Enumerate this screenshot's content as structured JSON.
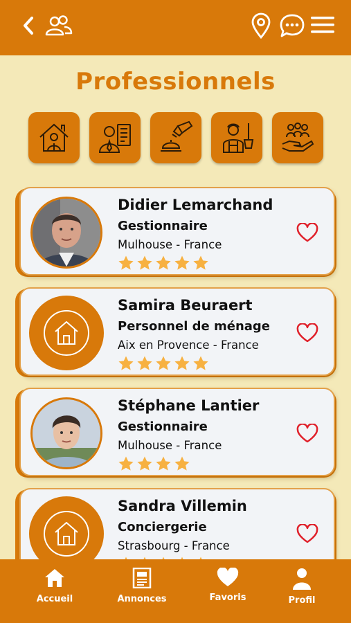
{
  "header": {
    "back_icon": "chevron-left-icon",
    "group_icon": "users-icon",
    "location_icon": "map-pin-icon",
    "chat_icon": "chat-bubble-icon",
    "menu_icon": "hamburger-icon"
  },
  "page": {
    "title": "Professionnels"
  },
  "categories": [
    {
      "icon": "house-person-icon"
    },
    {
      "icon": "manager-list-icon"
    },
    {
      "icon": "service-bell-icon"
    },
    {
      "icon": "housekeeper-icon"
    },
    {
      "icon": "community-hand-icon"
    }
  ],
  "professionals": [
    {
      "name": "Didier Lemarchand",
      "role": "Gestionnaire",
      "location": "Mulhouse - France",
      "rating": 5,
      "avatar": "photo"
    },
    {
      "name": "Samira Beuraert",
      "role": "Personnel de ménage",
      "location": "Aix en Provence - France",
      "rating": 5,
      "avatar": "house"
    },
    {
      "name": "Stéphane Lantier",
      "role": "Gestionnaire",
      "location": "Mulhouse - France",
      "rating": 4,
      "avatar": "photo"
    },
    {
      "name": "Sandra Villemin",
      "role": "Conciergerie",
      "location": "Strasbourg  - France",
      "rating": 5,
      "avatar": "house"
    }
  ],
  "tabs": [
    {
      "label": "Accueil",
      "icon": "home-icon"
    },
    {
      "label": "Annonces",
      "icon": "newspaper-icon"
    },
    {
      "label": "Favoris",
      "icon": "heart-icon"
    },
    {
      "label": "Profil",
      "icon": "user-icon"
    }
  ],
  "colors": {
    "accent": "#d8790a",
    "background": "#f4e9b8",
    "star": "#f7b141",
    "heart": "#e0202a"
  }
}
